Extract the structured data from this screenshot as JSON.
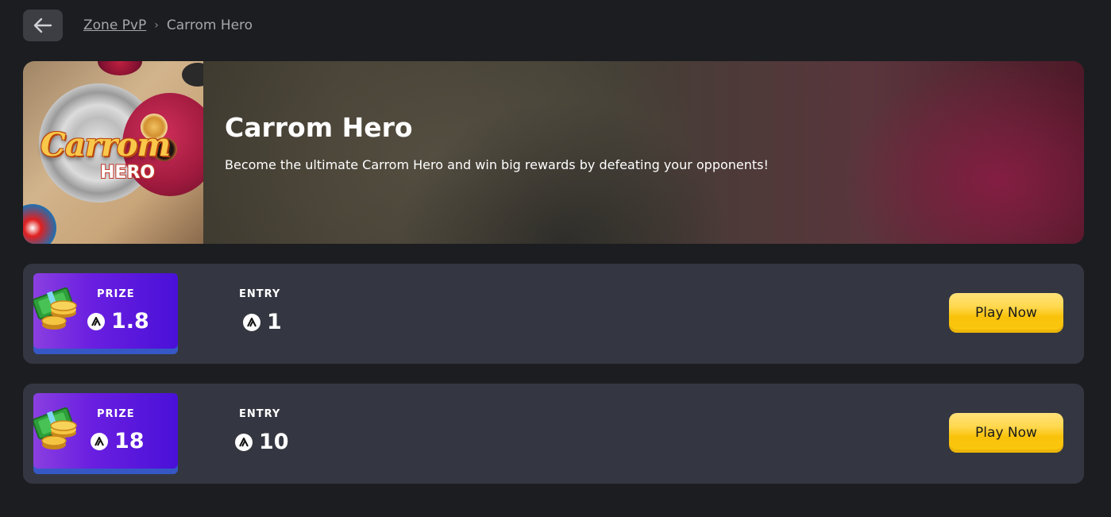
{
  "breadcrumb": {
    "parent": "Zone PvP",
    "separator": "›",
    "current": "Carrom Hero"
  },
  "icons": {
    "back": "arrow-left-icon",
    "token": "token-icon",
    "money": "money-coins-icon"
  },
  "game": {
    "title": "Carrom Hero",
    "description": "Become the ultimate Carrom Hero and win big rewards by defeating your opponents!",
    "thumbnail_logo": "Carrom",
    "thumbnail_sub": "HERO"
  },
  "matches": [
    {
      "prize_label": "PRIZE",
      "prize": "1.8",
      "entry_label": "ENTRY",
      "entry": "1",
      "button": "Play Now"
    },
    {
      "prize_label": "PRIZE",
      "prize": "18",
      "entry_label": "ENTRY",
      "entry": "10",
      "button": "Play Now"
    }
  ],
  "colors": {
    "background": "#1c1d21",
    "card": "#343741",
    "prize_gradient_start": "#8a3fe0",
    "prize_gradient_end": "#4a10d8",
    "play_button": "#fbc90f"
  }
}
